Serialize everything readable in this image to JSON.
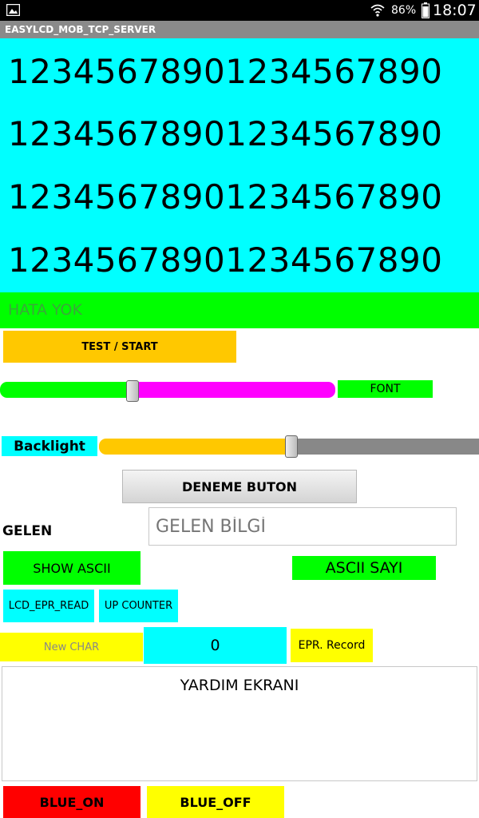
{
  "status_bar": {
    "battery_percent": "86%",
    "time": "18:07"
  },
  "app_title": "EASYLCD_MOB_TCP_SERVER",
  "lcd": {
    "lines": [
      "12345678901234567890",
      "12345678901234567890",
      "12345678901234567890",
      "12345678901234567890"
    ]
  },
  "error_bar": {
    "text": "HATA YOK"
  },
  "test_start_button": {
    "label": "TEST / START"
  },
  "font_slider": {
    "value_fraction": 0.395
  },
  "font_label": "FONT",
  "backlight": {
    "label": "Backlight",
    "value_fraction": 0.5
  },
  "deneme_button": {
    "label": "DENEME BUTON"
  },
  "gelen": {
    "label": "GELEN",
    "placeholder": "GELEN BİLGİ"
  },
  "show_ascii_button": {
    "label": "SHOW ASCII"
  },
  "ascii_sayi_label": "ASCII SAYI",
  "lcd_epr_read_button": {
    "label": "LCD_EPR_READ"
  },
  "up_counter_button": {
    "label": "UP COUNTER"
  },
  "new_char_button": {
    "label": "New CHAR"
  },
  "counter_value": "0",
  "epr_record_button": {
    "label": "EPR. Record"
  },
  "help_screen": {
    "title": "YARDIM EKRANI"
  },
  "blue_on_button": {
    "label": "BLUE_ON"
  },
  "blue_off_button": {
    "label": "BLUE_OFF"
  },
  "colors": {
    "cyan": "#00ffff",
    "green": "#00ff00",
    "orange": "#ffc800",
    "magenta": "#ff00ff",
    "yellow": "#ffff00",
    "red": "#ff0000",
    "gray": "#888888"
  }
}
